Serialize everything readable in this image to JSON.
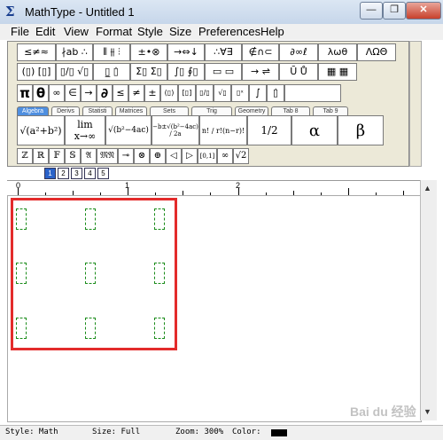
{
  "window": {
    "title": "MathType - Untitled 1",
    "app_icon": "Σ",
    "controls": [
      "—",
      "❐",
      "✕"
    ]
  },
  "menu": [
    "File",
    "Edit",
    "View",
    "Format",
    "Style",
    "Size",
    "Preferences",
    "Help"
  ],
  "symbol_row1": [
    "≤≠≈",
    "∤ab ∴",
    "⫴ ⫵ ⫶",
    "±•⊗",
    "→⇔↓",
    "∴∀∃",
    "∉∩⊂",
    "∂∞ℓ",
    "λωθ",
    "ΛΩΘ"
  ],
  "symbol_row2": [
    "(▯) [▯]",
    "▯/▯ √▯",
    "▯̲ ▯̇",
    "Σ▯ Σ▯",
    "∫▯ ∮▯",
    "▭ ▭",
    "→ ⇌",
    "Ū Ů",
    "▦ ▦"
  ],
  "symbol_row3": [
    "π",
    "θ",
    "∞",
    "∈",
    "→",
    "∂",
    "≤",
    "≠",
    "±",
    "(▯)",
    "[▯]",
    "▯/▯",
    "√▯",
    "▯ˣ",
    "∫",
    "▯̇"
  ],
  "tabs": [
    "Algebra",
    "Derivs",
    "Statisti",
    "Matrices",
    "Sets",
    "Trig",
    "Geometry",
    "Tab 8",
    "Tab 9"
  ],
  "active_tab": "Algebra",
  "templates": [
    "√(a²+b²)",
    "lim x→∞",
    "√(b²−4ac)",
    "−b±√(b²−4ac) / 2a",
    "n! / r!(n−r)!",
    "1/2",
    "α",
    "β"
  ],
  "bottom_row": [
    "ℤ",
    "ℝ",
    "𝔽",
    "𝕊",
    "𝔄",
    "𝔐𝔑",
    "⊸",
    "⊗",
    "⊕",
    "◁",
    "▷",
    "[0,1]",
    "∞",
    "√2"
  ],
  "size_tabs": [
    "1",
    "2",
    "3",
    "4",
    "5"
  ],
  "ruler_numbers": [
    "0",
    "1",
    "2"
  ],
  "status": {
    "style": "Style: Math",
    "size": "Size: Full",
    "zoom": "Zoom: 300%",
    "color": "Color:"
  },
  "watermark": "Bai du 经验",
  "colors": {
    "highlight": "#e32b2b",
    "placeholder": "#1a8c1a",
    "active_tab": "#4f8fe0"
  }
}
